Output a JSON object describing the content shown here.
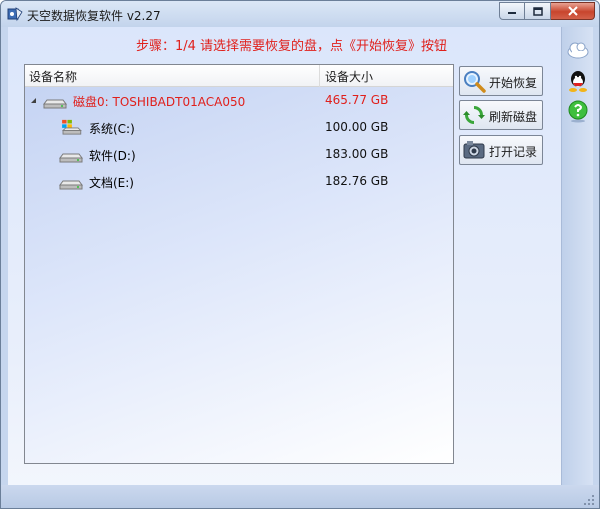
{
  "window": {
    "title": "天空数据恢复软件 v2.27"
  },
  "instruction": "步骤：1/4 请选择需要恢复的盘，点《开始恢复》按钮",
  "device_list": {
    "columns": [
      "设备名称",
      "设备大小"
    ],
    "rows": [
      {
        "name": "磁盘0: TOSHIBADT01ACA050",
        "size": "465.77 GB",
        "type": "disk"
      },
      {
        "name": "系统(C:)",
        "size": "100.00 GB",
        "type": "system-partition"
      },
      {
        "name": "软件(D:)",
        "size": "183.00 GB",
        "type": "partition"
      },
      {
        "name": "文档(E:)",
        "size": "182.76 GB",
        "type": "partition"
      }
    ]
  },
  "actions": {
    "start_label": "开始恢复",
    "refresh_label": "刷新磁盘",
    "open_label": "打开记录"
  },
  "colors": {
    "accent_red": "#e0201c",
    "window_bg": "#c6d6ee"
  },
  "icons": {
    "sidebar": [
      "cloud-icon",
      "qq-icon",
      "help-icon"
    ]
  }
}
